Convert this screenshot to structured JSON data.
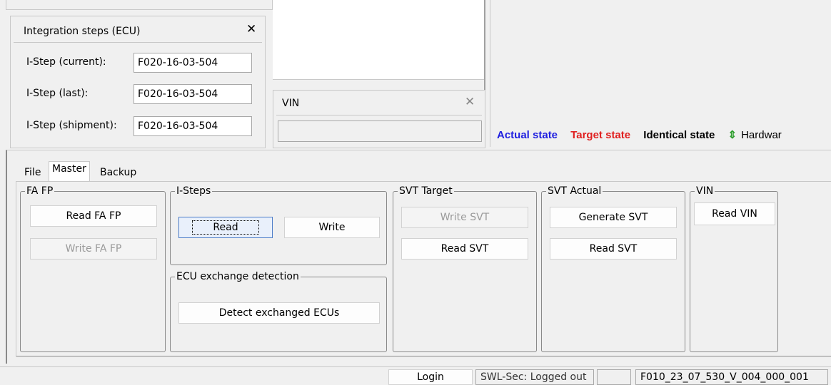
{
  "integration_panel": {
    "title": "Integration steps (ECU)",
    "close_glyph": "✕",
    "rows": [
      {
        "label": "I-Step (current):",
        "value": "F020-16-03-504"
      },
      {
        "label": "I-Step (last):",
        "value": "F020-16-03-504"
      },
      {
        "label": "I-Step (shipment):",
        "value": "F020-16-03-504"
      }
    ]
  },
  "vin_panel": {
    "title": "VIN",
    "close_glyph": "✕",
    "value": ""
  },
  "legend": {
    "actual": "Actual state",
    "target": "Target state",
    "identical": "Identical state",
    "hardware_icon": "⇕",
    "hardware": "Hardwar",
    "colors": {
      "actual": "#1f1fe0",
      "target": "#e01f1f",
      "identical": "#000000",
      "hardware_icon": "#2e9e2e"
    }
  },
  "tabs": [
    "File",
    "Master",
    "Backup"
  ],
  "active_tab": "Master",
  "groups": {
    "fafp": {
      "title": "FA FP",
      "read": "Read FA FP",
      "write": "Write FA FP"
    },
    "isteps": {
      "title": "I-Steps",
      "read": "Read",
      "write": "Write"
    },
    "ecu_exchange": {
      "title": "ECU exchange detection",
      "detect": "Detect exchanged ECUs"
    },
    "svt_target": {
      "title": "SVT Target",
      "write": "Write SVT",
      "read": "Read SVT"
    },
    "svt_actual": {
      "title": "SVT Actual",
      "generate": "Generate SVT",
      "read": "Read SVT"
    },
    "vin": {
      "title": "VIN",
      "read": "Read VIN"
    }
  },
  "status_bar": {
    "login": "Login",
    "swl_sec": "SWL-Sec: Logged out",
    "empty": "",
    "version": "F010_23_07_530_V_004_000_001"
  }
}
